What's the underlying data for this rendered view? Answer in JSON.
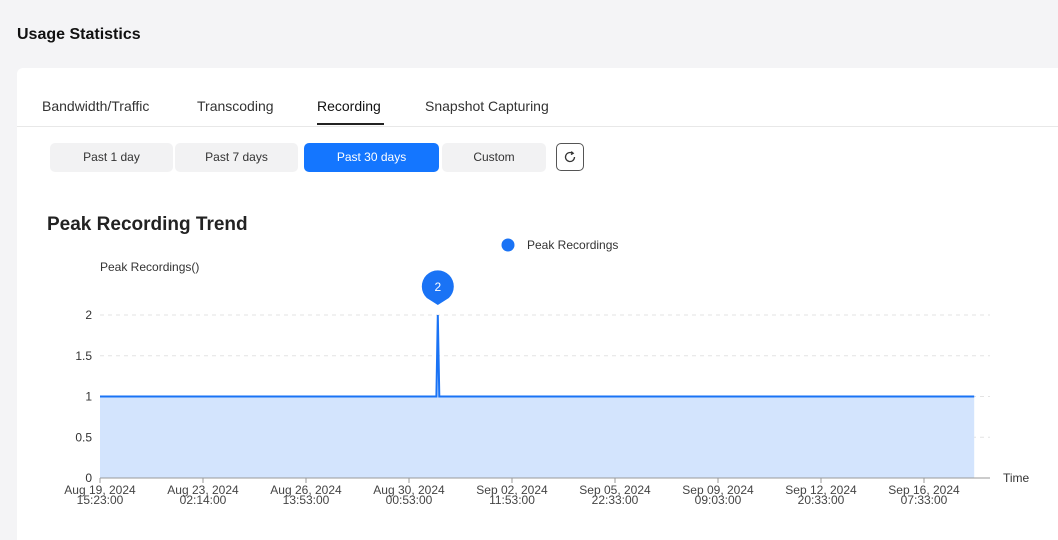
{
  "page": {
    "title": "Usage Statistics"
  },
  "tabs": [
    {
      "label": "Bandwidth/Traffic",
      "active": false
    },
    {
      "label": "Transcoding",
      "active": false
    },
    {
      "label": "Recording",
      "active": true
    },
    {
      "label": "Snapshot Capturing",
      "active": false
    }
  ],
  "time_ranges": [
    {
      "label": "Past 1 day",
      "active": false
    },
    {
      "label": "Past 7 days",
      "active": false
    },
    {
      "label": "Past 30 days",
      "active": true
    },
    {
      "label": "Custom",
      "active": false
    }
  ],
  "refresh": {
    "icon": "refresh-icon"
  },
  "colors": {
    "accent": "#1476ff",
    "series": "#1a73f5",
    "area": "#d3e4fd"
  },
  "chart_data": {
    "type": "area",
    "title": "Peak Recording Trend",
    "ylabel": "Peak Recordings()",
    "xlabel": "Time",
    "ylim": [
      0,
      2
    ],
    "yticks": [
      "0",
      "0.5",
      "1",
      "1.5",
      "2"
    ],
    "x_tick_labels": [
      [
        "Aug 19, 2024",
        "15:23:00"
      ],
      [
        "Aug 23, 2024",
        "02:14:00"
      ],
      [
        "Aug 26, 2024",
        "13:53:00"
      ],
      [
        "Aug 30, 2024",
        "00:53:00"
      ],
      [
        "Sep 02, 2024",
        "11:53:00"
      ],
      [
        "Sep 05, 2024",
        "22:33:00"
      ],
      [
        "Sep 09, 2024",
        "09:03:00"
      ],
      [
        "Sep 12, 2024",
        "20:33:00"
      ],
      [
        "Sep 16, 2024",
        "07:33:00"
      ]
    ],
    "legend": {
      "position": "top-center"
    },
    "series": [
      {
        "name": "Peak Recordings",
        "points": [
          {
            "x": "Aug 19, 2024 15:23:00",
            "y": 1
          },
          {
            "x": "Aug 30, 2024 22:30:00",
            "y": 1
          },
          {
            "x": "Aug 30, 2024 23:40:00",
            "y": 2
          },
          {
            "x": "Aug 31, 2024 00:50:00",
            "y": 1
          },
          {
            "x": "Sep 17, 2024 23:59:00",
            "y": 1
          }
        ]
      }
    ],
    "annotations": [
      {
        "type": "max-marker",
        "x": "Aug 30, 2024 23:40:00",
        "y": 2,
        "label": "2"
      }
    ],
    "grid": true
  }
}
